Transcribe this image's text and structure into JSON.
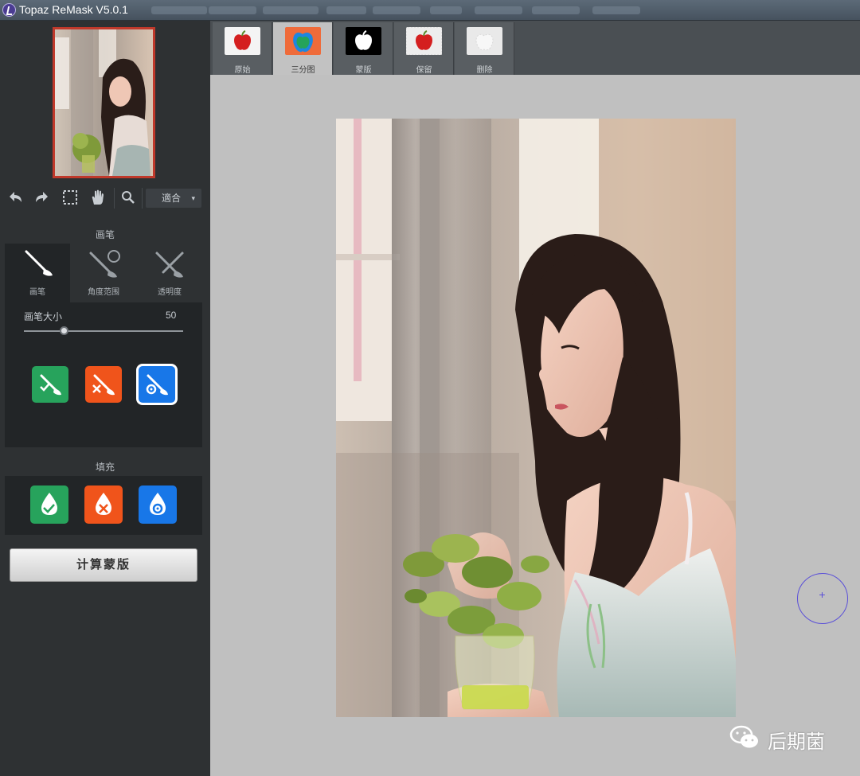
{
  "app": {
    "title": "Topaz ReMask V5.0.1"
  },
  "toolbar": {
    "zoom_value": "適合",
    "zoom_caret": "▾"
  },
  "brush": {
    "section_label": "画笔",
    "tabs": [
      {
        "label": "画笔",
        "icon": "brush-icon"
      },
      {
        "label": "角度范围",
        "icon": "brush-angle-icon"
      },
      {
        "label": "透明度",
        "icon": "brush-opacity-icon"
      }
    ],
    "size_label": "画笔大小",
    "size_value": "50",
    "size_fraction": 0.25,
    "modes": [
      {
        "name": "keep",
        "color": "#27a35c",
        "icon": "keep-brush-icon"
      },
      {
        "name": "cut",
        "color": "#f0541b",
        "icon": "cut-brush-icon"
      },
      {
        "name": "compute",
        "color": "#1877e8",
        "icon": "compute-brush-icon",
        "selected": true
      }
    ]
  },
  "fill": {
    "section_label": "填充",
    "modes": [
      {
        "name": "keep",
        "color": "#27a35c",
        "icon": "keep-fill-icon"
      },
      {
        "name": "cut",
        "color": "#f0541b",
        "icon": "cut-fill-icon"
      },
      {
        "name": "compute",
        "color": "#1877e8",
        "icon": "compute-fill-icon"
      }
    ]
  },
  "compute_button": {
    "label": "计算蒙版"
  },
  "view_tabs": [
    {
      "label": "原始",
      "active": false,
      "icon": "red-apple-icon"
    },
    {
      "label": "三分图",
      "active": true,
      "icon": "tricolor-apple-icon"
    },
    {
      "label": "蒙版",
      "active": false,
      "icon": "mask-apple-icon"
    },
    {
      "label": "保留",
      "active": false,
      "icon": "keep-apple-icon"
    },
    {
      "label": "删除",
      "active": false,
      "icon": "drop-apple-icon"
    }
  ],
  "watermark": {
    "text": "后期菌",
    "icon": "wechat-icon"
  },
  "colors": {
    "sidebar": "#2e3133",
    "panel": "#222527",
    "canvas": "#c0c0c0",
    "accent_red": "#c0392b",
    "cursor": "#5a4fd8"
  }
}
